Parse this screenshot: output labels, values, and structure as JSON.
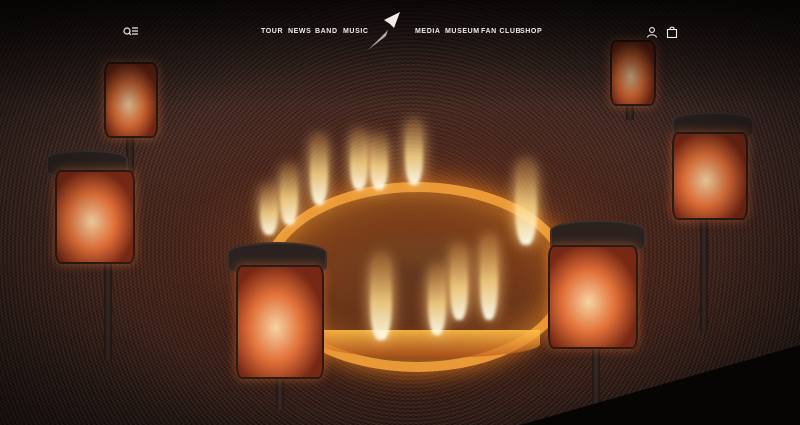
{
  "nav": {
    "left_links": [
      "TOUR",
      "NEWS",
      "BAND",
      "MUSIC"
    ],
    "right_links": [
      "MEDIA",
      "MUSEUM",
      "FAN CLUB",
      "SHOP"
    ],
    "icons": {
      "menu": "menu-search-icon",
      "logo": "metallica-ninja-star-logo",
      "account": "user-icon",
      "cart": "shopping-bag-icon"
    }
  },
  "hero": {
    "image": "aerial view of stadium concert with circular stage, pyrotechnics and video towers",
    "colors": {
      "accent": "#ff9a3c",
      "text": "#f2ecea"
    }
  }
}
